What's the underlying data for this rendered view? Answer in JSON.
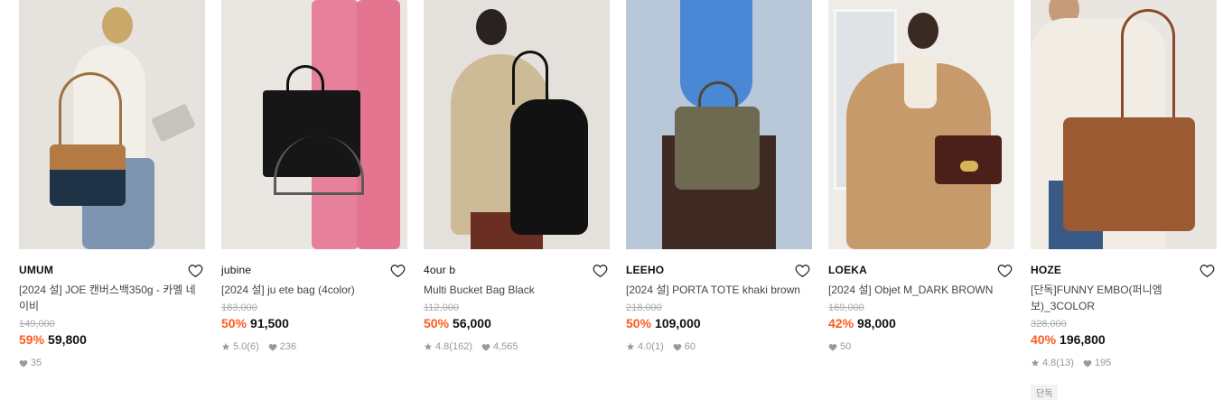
{
  "products": [
    {
      "brand": "UMUM",
      "name": "[2024 설] JOE 캔버스백350g - 카멜 네이비",
      "original_price": "149,000",
      "discount": "59%",
      "price": "59,800",
      "rating": "",
      "reviews": "",
      "likes": "35",
      "tag": ""
    },
    {
      "brand": "jubine",
      "name": "[2024 설] ju ete bag (4color)",
      "original_price": "183,000",
      "discount": "50%",
      "price": "91,500",
      "rating": "5.0",
      "reviews": "(6)",
      "likes": "236",
      "tag": ""
    },
    {
      "brand": "4our b",
      "name": "Multi Bucket Bag Black",
      "original_price": "112,000",
      "discount": "50%",
      "price": "56,000",
      "rating": "4.8",
      "reviews": "(162)",
      "likes": "4,565",
      "tag": ""
    },
    {
      "brand": "LEEHO",
      "name": "[2024 설] PORTA TOTE khaki brown",
      "original_price": "218,000",
      "discount": "50%",
      "price": "109,000",
      "rating": "4.0",
      "reviews": "(1)",
      "likes": "60",
      "tag": ""
    },
    {
      "brand": "LOEKA",
      "name": "[2024 설] Objet M_DARK BROWN",
      "original_price": "169,000",
      "discount": "42%",
      "price": "98,000",
      "rating": "",
      "reviews": "",
      "likes": "50",
      "tag": ""
    },
    {
      "brand": "HOZE",
      "name": "[단독]FUNNY EMBO(퍼니엠보)_3COLOR",
      "original_price": "328,000",
      "discount": "40%",
      "price": "196,800",
      "rating": "4.8",
      "reviews": "(13)",
      "likes": "195",
      "tag": "단독"
    }
  ],
  "colors": {
    "discount": "#ff5a1f",
    "meta_text": "#999999",
    "strike_text": "#aaaaaa"
  },
  "icons": {
    "wishlist": "heart-outline-icon",
    "rating": "star-icon",
    "likes": "heart-filled-icon"
  }
}
